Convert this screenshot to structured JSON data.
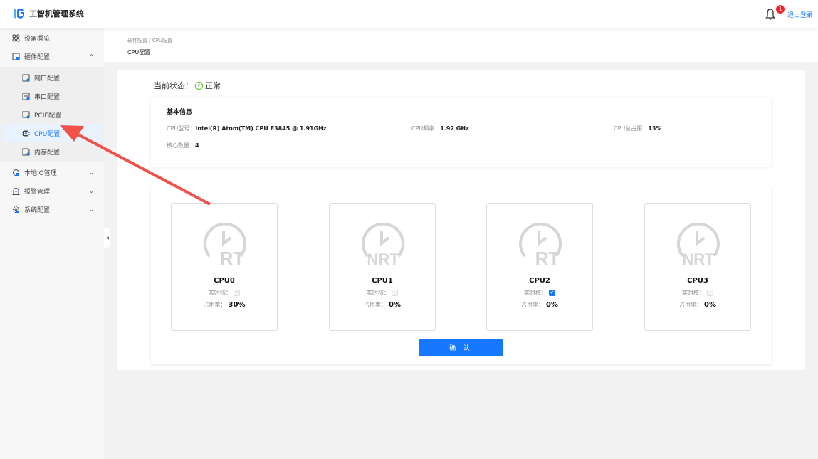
{
  "header": {
    "app_title": "工智机管理系统",
    "notification_count": "1",
    "logout_label": "退出登录"
  },
  "sidebar": {
    "items": [
      {
        "label": "设备概览"
      },
      {
        "label": "硬件配置",
        "children": [
          {
            "label": "网口配置"
          },
          {
            "label": "串口配置"
          },
          {
            "label": "PCIE配置"
          },
          {
            "label": "CPU配置"
          },
          {
            "label": "内存配置"
          }
        ]
      },
      {
        "label": "本地IO管理"
      },
      {
        "label": "报警管理"
      },
      {
        "label": "系统配置"
      }
    ]
  },
  "breadcrumb": {
    "parent": "硬件配置",
    "separator": "/",
    "current": "CPU配置"
  },
  "page_title": "CPU配置",
  "status": {
    "label": "当前状态：",
    "value": "正常"
  },
  "basic_info": {
    "title": "基本信息",
    "model_label": "CPU型号：",
    "model": "Intel(R) Atom(TM) CPU E3845 @ 1.91GHz",
    "freq_label": "CPU频率：",
    "freq": "1.92 GHz",
    "usage_label": "CPU总占用：",
    "usage": "13%",
    "cores_label": "核心数量：",
    "cores": "4"
  },
  "cpus": [
    {
      "name": "CPU0",
      "mode": "RT",
      "realtime": true,
      "disabled": true,
      "usage": "30%"
    },
    {
      "name": "CPU1",
      "mode": "NRT",
      "realtime": false,
      "disabled": true,
      "usage": "0%"
    },
    {
      "name": "CPU2",
      "mode": "RT",
      "realtime": true,
      "disabled": false,
      "usage": "0%"
    },
    {
      "name": "CPU3",
      "mode": "NRT",
      "realtime": false,
      "disabled": true,
      "usage": "0%"
    }
  ],
  "cpu_labels": {
    "realtime": "实时核：",
    "usage": "占用率："
  },
  "confirm_label": "确 认",
  "colors": {
    "accent": "#1677ff",
    "ok": "#52c41a",
    "annotation": "#f0524a"
  }
}
